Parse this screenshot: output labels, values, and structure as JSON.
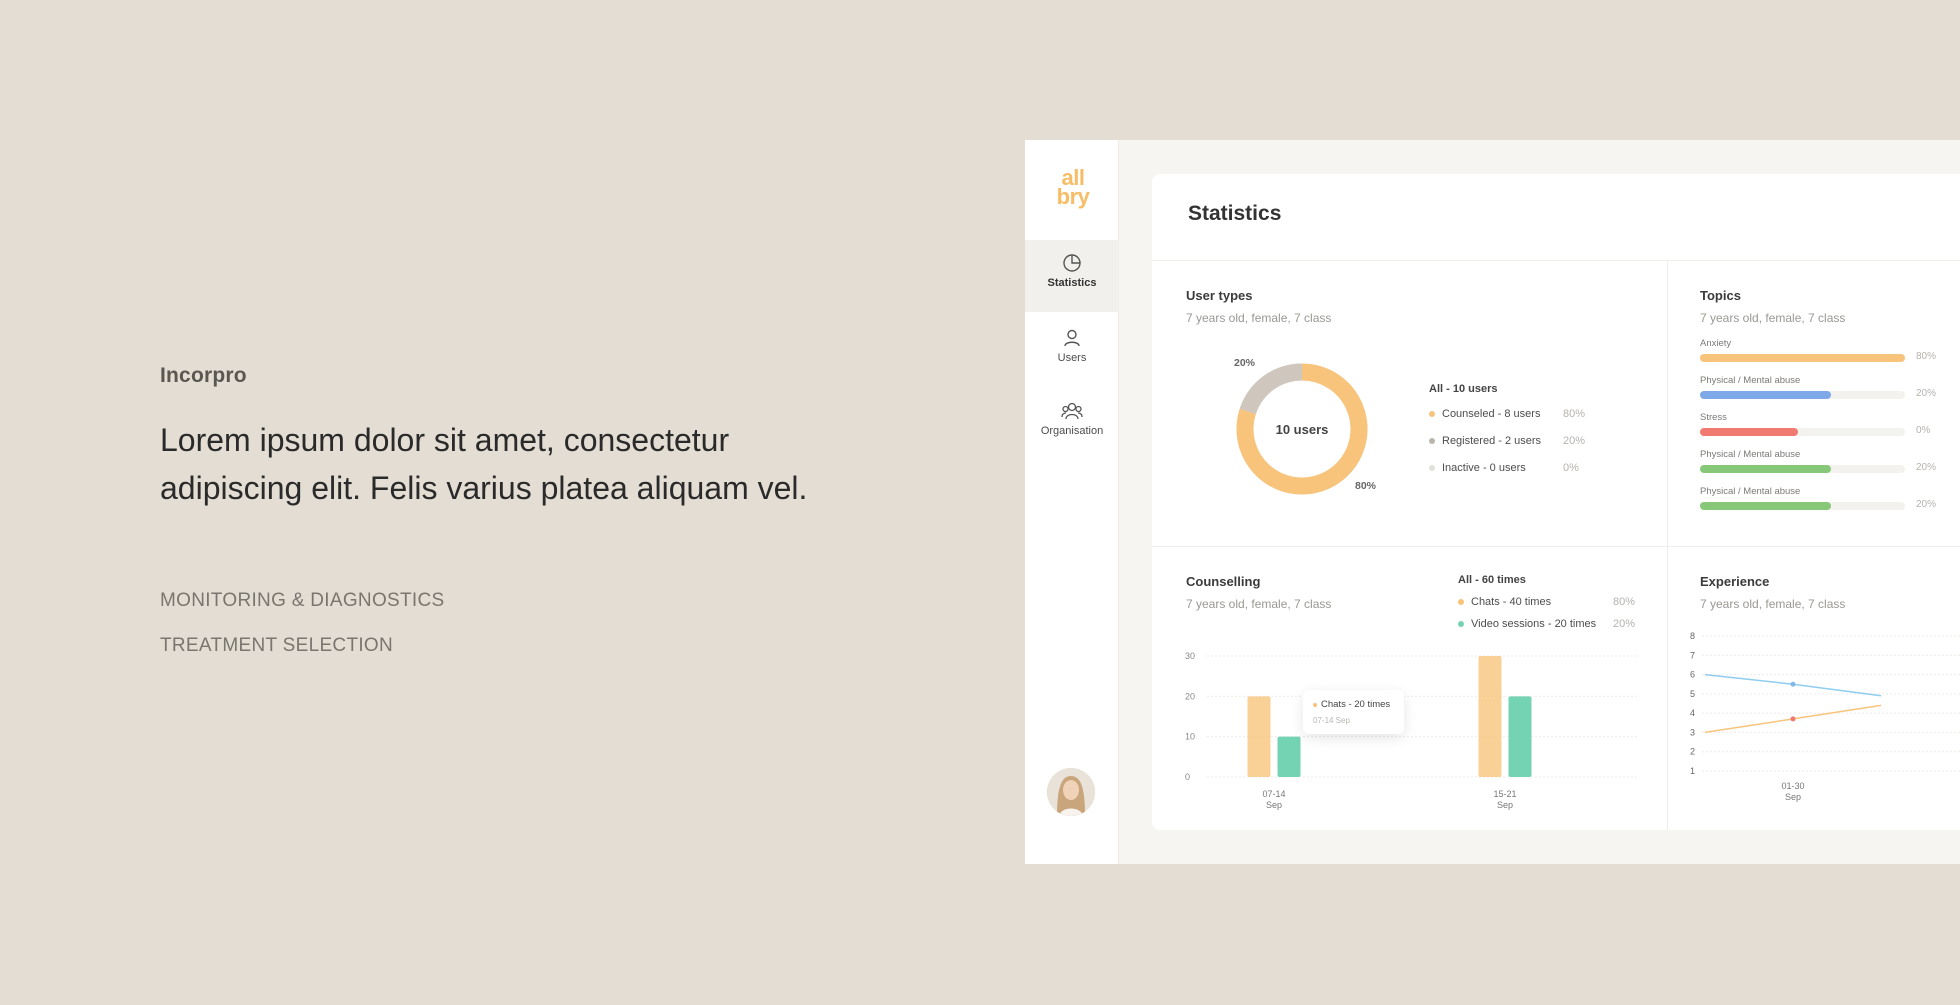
{
  "copy": {
    "brand": "Incorpro",
    "headline_line1": "Lorem ipsum dolor sit amet, consectetur",
    "headline_line2": "adipiscing elit. Felis varius platea aliquam vel.",
    "tags": [
      "MONITORING & DIAGNOSTICS",
      "TREATMENT SELECTION"
    ]
  },
  "app": {
    "logo_line1": "all",
    "logo_line2": "bry",
    "nav": [
      {
        "label": "Statistics",
        "icon": "pie-chart-icon",
        "active": true
      },
      {
        "label": "Users",
        "icon": "user-icon",
        "active": false
      },
      {
        "label": "Organisation",
        "icon": "organisation-icon",
        "active": false
      }
    ],
    "page_title": "Statistics"
  },
  "colors": {
    "orange": "#f8c47c",
    "teal": "#74d3b3",
    "blue": "#7fa8e8",
    "red": "#f17a70",
    "green": "#86c878",
    "gray": "#cfc7bd",
    "lightgray": "#e2e0dd"
  },
  "user_types": {
    "title": "User types",
    "subtitle": "7 years old, female, 7 class",
    "center_label": "10 users",
    "label_20": "20%",
    "label_80": "80%",
    "legend_title": "All - 10 users",
    "legend": [
      {
        "label": "Counseled - 8 users",
        "pct": "80%",
        "color": "#f8c47c"
      },
      {
        "label": "Registered - 2 users",
        "pct": "20%",
        "color": "#b9b4ad"
      },
      {
        "label": "Inactive - 0 users",
        "pct": "0%",
        "color": "#e2e0dd"
      }
    ]
  },
  "topics": {
    "title": "Topics",
    "subtitle": "7 years old, female, 7 class",
    "items": [
      {
        "label": "Anxiety",
        "pct": "80%",
        "value": 1.0,
        "color": "#f8c47c"
      },
      {
        "label": "Physical / Mental abuse",
        "pct": "20%",
        "value": 0.64,
        "color": "#7fa8e8"
      },
      {
        "label": "Stress",
        "pct": "0%",
        "value": 0.48,
        "color": "#f17a70"
      },
      {
        "label": "Physical / Mental abuse",
        "pct": "20%",
        "value": 0.64,
        "color": "#86c878"
      },
      {
        "label": "Physical / Mental abuse",
        "pct": "20%",
        "value": 0.64,
        "color": "#86c878"
      }
    ]
  },
  "counselling": {
    "title": "Counselling",
    "subtitle": "7 years old, female, 7 class",
    "legend_title": "All - 60 times",
    "legend": [
      {
        "label": "Chats - 40 times",
        "pct": "80%",
        "color": "#f8c47c"
      },
      {
        "label": "Video sessions - 20 times",
        "pct": "20%",
        "color": "#74d3b3"
      }
    ],
    "tooltip_main": "Chats - 20 times",
    "tooltip_sub": "07-14 Sep"
  },
  "experience": {
    "title": "Experience",
    "subtitle": "7 years old, female, 7 class"
  },
  "chart_data": [
    {
      "type": "pie",
      "title": "User types",
      "categories": [
        "Counseled",
        "Registered",
        "Inactive"
      ],
      "values": [
        8,
        2,
        0
      ]
    },
    {
      "type": "bar",
      "title": "Counselling",
      "categories": [
        "07-14 Sep",
        "15-21 Sep"
      ],
      "tick_top": [
        "07-14",
        "15-21"
      ],
      "tick_bottom": [
        "Sep",
        "Sep"
      ],
      "series": [
        {
          "name": "Chats",
          "values": [
            20,
            30
          ],
          "color": "#f8c47c"
        },
        {
          "name": "Video sessions",
          "values": [
            10,
            20
          ],
          "color": "#74d3b3"
        }
      ],
      "ylim": [
        0,
        30
      ],
      "yticks": [
        0,
        10,
        20,
        30
      ]
    },
    {
      "type": "line",
      "title": "Experience",
      "x": [
        0,
        1,
        2
      ],
      "x_tick_top": "01-30",
      "x_tick_bottom": "Sep",
      "series": [
        {
          "values": [
            6.0,
            5.5,
            4.9
          ],
          "color": "#8fcdf0",
          "marker_color": "#7fb8ea"
        },
        {
          "values": [
            3.0,
            3.7,
            4.4
          ],
          "color": "#f8c47c",
          "marker_color": "#f17a70"
        }
      ],
      "ylim": [
        1,
        8
      ],
      "yticks": [
        1,
        2,
        3,
        4,
        5,
        6,
        7,
        8
      ]
    }
  ]
}
